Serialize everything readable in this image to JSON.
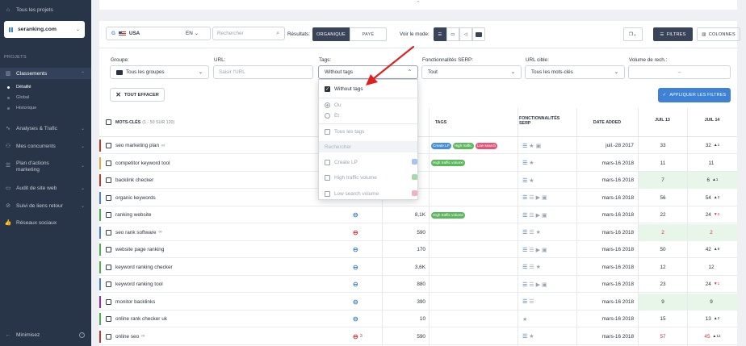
{
  "sidebar": {
    "all_projects": "Tous les projets",
    "project_name": "seranking.com",
    "section_label": "PROJETS",
    "nav": [
      {
        "label": "Classements",
        "icon": "chart-icon",
        "active": true
      },
      {
        "label": "Analyses & Trafic",
        "icon": "analytics-icon"
      },
      {
        "label": "Mes concurrents",
        "icon": "competitors-icon"
      },
      {
        "label": "Plan d'actions marketing",
        "icon": "checklist-icon"
      },
      {
        "label": "Audit de site web",
        "icon": "audit-icon"
      },
      {
        "label": "Suivi de liens retour",
        "icon": "backlinks-icon"
      },
      {
        "label": "Réseaux sociaux",
        "icon": "social-icon"
      }
    ],
    "sub": [
      "Détaillé",
      "Global",
      "Historique"
    ],
    "minimize": "Minimisez"
  },
  "toolbar": {
    "search_engine": "USA",
    "language": "EN",
    "search_placeholder": "Rechercher",
    "results_label": "Résultats:",
    "organic": "ORGANIQUE",
    "paid": "PAYÉ",
    "view_mode": "Voir le mode:",
    "filters": "FILTRES",
    "columns": "COLONNES"
  },
  "filters": {
    "group_label": "Groupe:",
    "group_value": "Tous les groupes",
    "url_label": "URL:",
    "url_placeholder": "Saisir l'URL",
    "tags_label": "Tags:",
    "tags_value": "Without tags",
    "serp_label": "Fonctionnalités SERP:",
    "serp_value": "Tout",
    "target_label": "URL cible:",
    "target_value": "Tous les mots-clés",
    "volume_label": "Volume de rech.:",
    "volume_sep": "–",
    "clear": "TOUT EFFACER",
    "apply": "APPLIQUER LES FILTRES"
  },
  "dropdown": {
    "without_tags": "Without tags",
    "ou": "Ou",
    "et": "Et",
    "all_tags": "Tous les tags",
    "search": "Rechercher",
    "tags": [
      {
        "label": "Create LP",
        "color": "#a7c4ee"
      },
      {
        "label": "High traffic volume",
        "color": "#a8d8a8"
      },
      {
        "label": "Low search volume",
        "color": "#f1b1bf"
      }
    ]
  },
  "table": {
    "headers": {
      "keywords": "MOTS-CLÉS",
      "keywords_count": "(1 - 50 SUR 120)",
      "tags": "TAGS",
      "serp": "FONCTIONNALITÉS SERP",
      "date": "DATE ADDED",
      "jul13": "JUIL 13",
      "jul14": "JUIL 14"
    },
    "rows": [
      {
        "kw": "seo marketing plan",
        "vol": "",
        "date": "juil.-28 2017",
        "d13": "33",
        "d14": "32",
        "ch": "▲1",
        "chc": "#2b3240",
        "bar": "#c0392b",
        "bg13": "",
        "bg14": ""
      },
      {
        "kw": "competitor keyword tool",
        "vol": "",
        "date": "mars-16 2018",
        "d13": "11",
        "d14": "11",
        "ch": "",
        "chc": "#2b3240",
        "bar": "#e0a93a",
        "bg13": "",
        "bg14": ""
      },
      {
        "kw": "backlink checker",
        "vol": "",
        "date": "mars-16 2018",
        "d13": "7",
        "d14": "6",
        "ch": "▲1",
        "chc": "#2b3240",
        "bar": "#c0392b",
        "bg13": "#e8f6ea",
        "bg14": "#e8f6ea"
      },
      {
        "kw": "organic keywords",
        "vol": "",
        "date": "mars-16 2018",
        "d13": "56",
        "d14": "54",
        "ch": "▲2",
        "chc": "#2b3240",
        "bar": "#4a7fd4",
        "bg13": "",
        "bg14": ""
      },
      {
        "kw": "ranking website",
        "vol": "8,1K",
        "date": "mars-16 2018",
        "d13": "22",
        "d14": "24",
        "ch": "▼2",
        "chc": "#d9303a",
        "bar": "#4caf50",
        "bg13": "",
        "bg14": ""
      },
      {
        "kw": "seo rank software",
        "vol": "590",
        "date": "mars-16 2018",
        "d13": "2",
        "d14": "2",
        "ch": "",
        "chc": "#2b3240",
        "bar": "#4a7fd4",
        "bg13": "#e8f6ea",
        "bg14": "#e8f6ea"
      },
      {
        "kw": "website page ranking",
        "vol": "170",
        "date": "mars-16 2018",
        "d13": "50",
        "d14": "42",
        "ch": "▲8",
        "chc": "#2b3240",
        "bar": "#4caf50",
        "bg13": "",
        "bg14": ""
      },
      {
        "kw": "keyword ranking checker",
        "vol": "3,6K",
        "date": "mars-16 2018",
        "d13": "12",
        "d14": "12",
        "ch": "",
        "chc": "#2b3240",
        "bar": "#4caf50",
        "bg13": "",
        "bg14": ""
      },
      {
        "kw": "keyword ranking tool",
        "vol": "880",
        "date": "mars-16 2018",
        "d13": "23",
        "d14": "24",
        "ch": "▼1",
        "chc": "#d9303a",
        "bar": "#4a7fd4",
        "bg13": "",
        "bg14": ""
      },
      {
        "kw": "monitor backlinks",
        "vol": "390",
        "date": "mars-16 2018",
        "d13": "9",
        "d14": "9",
        "ch": "",
        "chc": "#2b3240",
        "bar": "#9c27b0",
        "bg13": "#e8f6ea",
        "bg14": "#e8f6ea"
      },
      {
        "kw": "online rank checker uk",
        "vol": "10",
        "date": "mars-16 2018",
        "d13": "15",
        "d14": "13",
        "ch": "▲2",
        "chc": "#2b3240",
        "bar": "#4caf50",
        "bg13": "",
        "bg14": ""
      },
      {
        "kw": "online seo",
        "vol": "590",
        "date": "mars-16 2018",
        "d13": "57",
        "d14": "45",
        "ch": "▲12",
        "chc": "#2b3240",
        "bar": "#c0392b",
        "bg13": "",
        "bg14": ""
      }
    ],
    "row_tags": {
      "0": [
        {
          "label": "Create LP",
          "color": "#4a90d9"
        },
        {
          "label": "High traffic",
          "color": "#5cb85c"
        },
        {
          "label": "Low search",
          "color": "#e2567a"
        }
      ],
      "1": [
        {
          "label": "High traffic volume",
          "color": "#5cb85c"
        }
      ],
      "4": [
        {
          "label": "High traffic volume",
          "color": "#5cb85c"
        }
      ]
    },
    "link_count_last": "3"
  },
  "colors": {
    "accent": "#3d82d6",
    "sidebar": "#283447",
    "active_seg": "#3a4458"
  }
}
